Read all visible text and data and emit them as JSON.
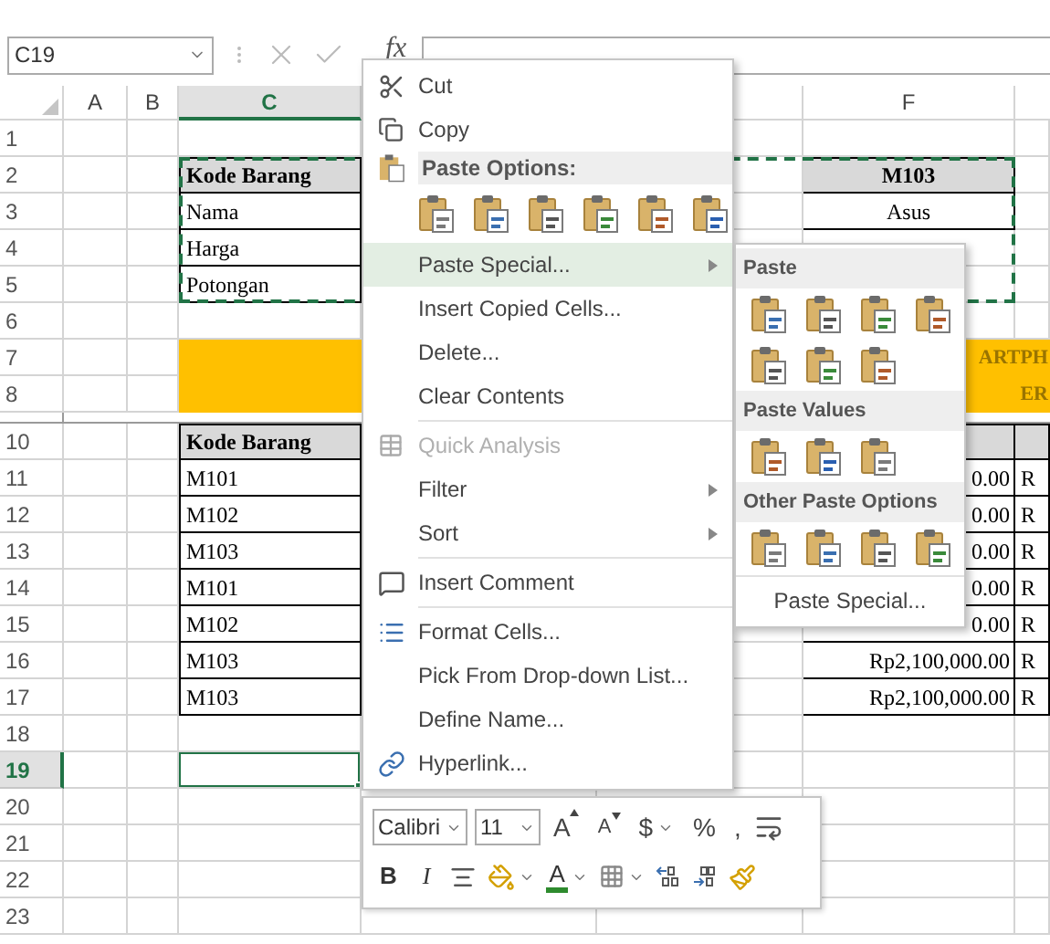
{
  "formula_bar": {
    "name_box": "C19",
    "fx": "fx"
  },
  "clipboard_marquee": true,
  "columns": [
    {
      "label": "A",
      "selected": false
    },
    {
      "label": "B",
      "selected": false
    },
    {
      "label": "C",
      "selected": true
    },
    {
      "label": "F",
      "selected": false
    }
  ],
  "rows": [
    {
      "number": "1",
      "selected": false
    },
    {
      "number": "2",
      "selected": false,
      "c": {
        "text": "Kode Barang",
        "kind": "header"
      },
      "f": {
        "text": "M103",
        "kind": "header_center"
      }
    },
    {
      "number": "3",
      "selected": false,
      "c": {
        "text": "Nama",
        "kind": "label"
      },
      "f": {
        "text": "Asus",
        "kind": "center"
      }
    },
    {
      "number": "4",
      "selected": false,
      "c": {
        "text": "Harga",
        "kind": "label"
      }
    },
    {
      "number": "5",
      "selected": false,
      "c": {
        "text": "Potongan",
        "kind": "label"
      }
    },
    {
      "number": "6",
      "selected": false
    },
    {
      "number": "7",
      "selected": false,
      "c": {
        "kind": "band"
      },
      "f": {
        "text": "ARTPH",
        "kind": "title"
      }
    },
    {
      "number": "8",
      "selected": false,
      "c": {
        "kind": "band"
      },
      "f": {
        "text": "ER",
        "kind": "title"
      }
    },
    {
      "collapsed": true
    },
    {
      "number": "10",
      "selected": false,
      "c": {
        "text": "Kode Barang",
        "kind": "header"
      },
      "f": {
        "kind": "header"
      },
      "g": {
        "kind": "header"
      }
    },
    {
      "number": "11",
      "selected": false,
      "c": {
        "text": "M101",
        "kind": "label"
      },
      "f": {
        "text": "0.00",
        "kind": "money"
      },
      "g": {
        "text": "R",
        "kind": "label"
      }
    },
    {
      "number": "12",
      "selected": false,
      "c": {
        "text": "M102",
        "kind": "label"
      },
      "f": {
        "text": "0.00",
        "kind": "money"
      },
      "g": {
        "text": "R",
        "kind": "label"
      }
    },
    {
      "number": "13",
      "selected": false,
      "c": {
        "text": "M103",
        "kind": "label"
      },
      "f": {
        "text": "0.00",
        "kind": "money"
      },
      "g": {
        "text": "R",
        "kind": "label"
      }
    },
    {
      "number": "14",
      "selected": false,
      "c": {
        "text": "M101",
        "kind": "label"
      },
      "f": {
        "text": "0.00",
        "kind": "money"
      },
      "g": {
        "text": "R",
        "kind": "label"
      }
    },
    {
      "number": "15",
      "selected": false,
      "c": {
        "text": "M102",
        "kind": "label"
      },
      "f": {
        "text": "0.00",
        "kind": "money"
      },
      "g": {
        "text": "R",
        "kind": "label"
      }
    },
    {
      "number": "16",
      "selected": false,
      "c": {
        "text": "M103",
        "kind": "label"
      },
      "f": {
        "text": "Rp2,100,000.00",
        "kind": "money"
      },
      "g": {
        "text": "R",
        "kind": "label"
      }
    },
    {
      "number": "17",
      "selected": false,
      "c": {
        "text": "M103",
        "kind": "label"
      },
      "f": {
        "text": "Rp2,100,000.00",
        "kind": "money"
      },
      "g": {
        "text": "R",
        "kind": "label"
      }
    },
    {
      "number": "18",
      "selected": false
    },
    {
      "number": "19",
      "selected": true
    },
    {
      "number": "20",
      "selected": false
    },
    {
      "number": "21",
      "selected": false
    },
    {
      "number": "22",
      "selected": false
    },
    {
      "number": "23",
      "selected": false
    }
  ],
  "context_menu": [
    {
      "kind": "item",
      "label": "Cut",
      "selected": false,
      "disabled": false,
      "submenu": false
    },
    {
      "kind": "item",
      "label": "Copy",
      "selected": false,
      "disabled": false,
      "submenu": false
    },
    {
      "kind": "header",
      "label": "Paste Options:"
    },
    {
      "kind": "icons"
    },
    {
      "kind": "item",
      "label": "Paste Special...",
      "selected": true,
      "disabled": false,
      "submenu": true
    },
    {
      "kind": "item",
      "label": "Insert Copied Cells...",
      "selected": false,
      "disabled": false,
      "submenu": false
    },
    {
      "kind": "item",
      "label": "Delete...",
      "selected": false,
      "disabled": false,
      "submenu": false
    },
    {
      "kind": "item",
      "label": "Clear Contents",
      "selected": false,
      "disabled": false,
      "submenu": false
    },
    {
      "kind": "separator"
    },
    {
      "kind": "item",
      "label": "Quick Analysis",
      "selected": false,
      "disabled": true,
      "submenu": false
    },
    {
      "kind": "item",
      "label": "Filter",
      "selected": false,
      "disabled": false,
      "submenu": true
    },
    {
      "kind": "item",
      "label": "Sort",
      "selected": false,
      "disabled": false,
      "submenu": true
    },
    {
      "kind": "separator"
    },
    {
      "kind": "item",
      "label": "Insert Comment",
      "selected": false,
      "disabled": false,
      "submenu": false
    },
    {
      "kind": "separator"
    },
    {
      "kind": "item",
      "label": "Format Cells...",
      "selected": false,
      "disabled": false,
      "submenu": false
    },
    {
      "kind": "item",
      "label": "Pick From Drop-down List...",
      "selected": false,
      "disabled": false,
      "submenu": false
    },
    {
      "kind": "item",
      "label": "Define Name...",
      "selected": false,
      "disabled": false,
      "submenu": false
    },
    {
      "kind": "item",
      "label": "Hyperlink...",
      "selected": false,
      "disabled": false,
      "submenu": false
    }
  ],
  "paste_submenu": [
    {
      "kind": "header",
      "label": "Paste"
    },
    {
      "kind": "icons"
    },
    {
      "kind": "icons"
    },
    {
      "kind": "header",
      "label": "Paste Values"
    },
    {
      "kind": "icons"
    },
    {
      "kind": "header",
      "label": "Other Paste Options"
    },
    {
      "kind": "icons"
    },
    {
      "kind": "separator"
    },
    {
      "kind": "item",
      "label": "Paste Special..."
    }
  ],
  "mini_toolbar": {
    "font_box": "Calibri",
    "size_box": "11",
    "top_buttons": [
      {
        "kind": "grow",
        "label": "A"
      },
      {
        "kind": "shrink",
        "label": "A"
      },
      {
        "kind": "currency",
        "label": "$"
      },
      {
        "kind": "plain",
        "label": "%"
      },
      {
        "kind": "plain",
        "label": ","
      },
      {
        "kind": "wrap"
      }
    ],
    "bottom_buttons": [
      {
        "kind": "bold",
        "label": "B"
      },
      {
        "kind": "italic",
        "label": "I"
      },
      {
        "kind": "align"
      },
      {
        "kind": "fill"
      },
      {
        "kind": "fontcolor",
        "label": "A"
      },
      {
        "kind": "borders"
      },
      {
        "kind": "incdec"
      },
      {
        "kind": "decdec"
      },
      {
        "kind": "brush"
      }
    ]
  }
}
